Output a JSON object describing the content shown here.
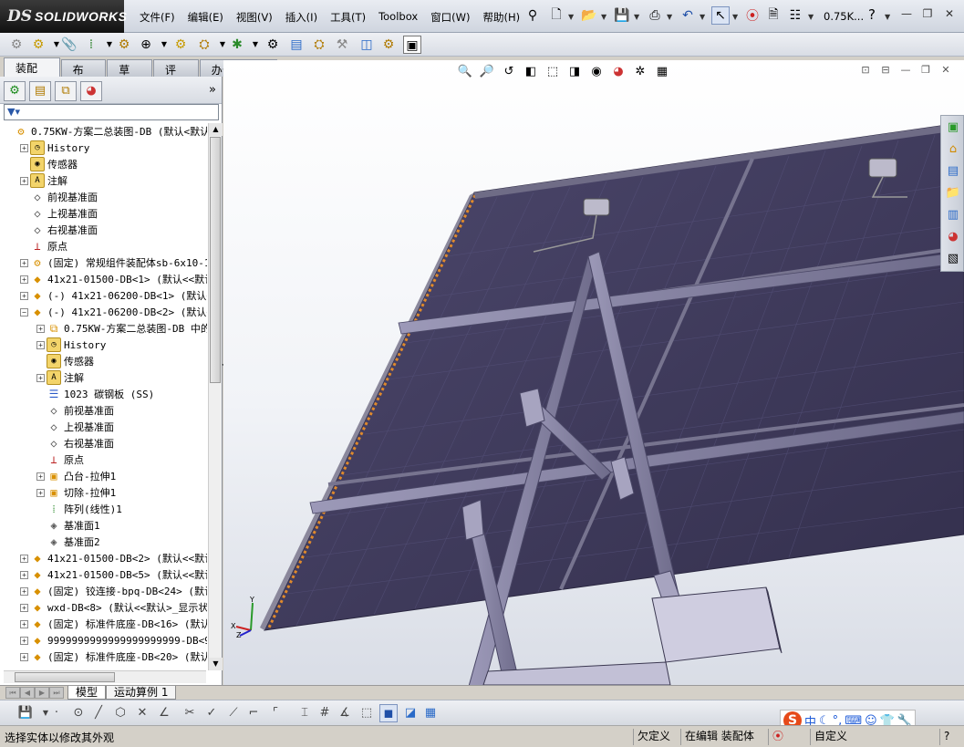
{
  "app": {
    "logo_ds": "DS",
    "logo_name": "SOLIDWORKS",
    "doc_name": "0.75K...",
    "help": "?"
  },
  "menu": [
    "文件(F)",
    "编辑(E)",
    "视图(V)",
    "插入(I)",
    "工具(T)",
    "Toolbox",
    "窗口(W)",
    "帮助(H)"
  ],
  "command_tabs": [
    "装配体",
    "布局",
    "草图",
    "评估",
    "办公室产品"
  ],
  "tree": [
    {
      "text": "0.75KW-方案二总装图-DB  (默认<默认_",
      "icon": "assembly-icon",
      "glyph": "⚙",
      "exp": "",
      "indent": 0
    },
    {
      "text": "History",
      "icon": "history-icon",
      "glyph": "◷",
      "exp": "+",
      "indent": 1
    },
    {
      "text": "传感器",
      "icon": "sensor-icon",
      "glyph": "◉",
      "exp": "",
      "indent": 1
    },
    {
      "text": "注解",
      "icon": "annotation-icon",
      "glyph": "A",
      "exp": "+",
      "indent": 1
    },
    {
      "text": "前视基准面",
      "icon": "plane-icon",
      "glyph": "◇",
      "exp": "",
      "indent": 1
    },
    {
      "text": "上视基准面",
      "icon": "plane-icon",
      "glyph": "◇",
      "exp": "",
      "indent": 1
    },
    {
      "text": "右视基准面",
      "icon": "plane-icon",
      "glyph": "◇",
      "exp": "",
      "indent": 1
    },
    {
      "text": "原点",
      "icon": "origin-icon",
      "glyph": "⊥",
      "exp": "",
      "indent": 1
    },
    {
      "text": "(固定) 常规组件装配体sb-6x10-15",
      "icon": "subassembly-icon",
      "glyph": "⚙",
      "exp": "+",
      "indent": 1
    },
    {
      "text": "41x21-01500-DB<1> (默认<<默认>_",
      "icon": "part-icon",
      "glyph": "◆",
      "exp": "+",
      "indent": 1
    },
    {
      "text": "(-) 41x21-06200-DB<1> (默认<<默",
      "icon": "part-icon",
      "glyph": "◆",
      "exp": "+",
      "indent": 1
    },
    {
      "text": "(-) 41x21-06200-DB<2> (默认<<默",
      "icon": "part-icon",
      "glyph": "◆",
      "exp": "−",
      "indent": 1
    },
    {
      "text": "0.75KW-方案二总装图-DB 中的配",
      "icon": "mates-icon",
      "glyph": "⧉",
      "exp": "+",
      "indent": 2
    },
    {
      "text": "History",
      "icon": "history-icon",
      "glyph": "◷",
      "exp": "+",
      "indent": 2
    },
    {
      "text": "传感器",
      "icon": "sensor-icon",
      "glyph": "◉",
      "exp": "",
      "indent": 2
    },
    {
      "text": "注解",
      "icon": "annotation-icon",
      "glyph": "A",
      "exp": "+",
      "indent": 2
    },
    {
      "text": "1023 碳钢板 (SS)",
      "icon": "material-icon",
      "glyph": "☰",
      "exp": "",
      "indent": 2
    },
    {
      "text": "前视基准面",
      "icon": "plane-icon",
      "glyph": "◇",
      "exp": "",
      "indent": 2
    },
    {
      "text": "上视基准面",
      "icon": "plane-icon",
      "glyph": "◇",
      "exp": "",
      "indent": 2
    },
    {
      "text": "右视基准面",
      "icon": "plane-icon",
      "glyph": "◇",
      "exp": "",
      "indent": 2
    },
    {
      "text": "原点",
      "icon": "origin-icon",
      "glyph": "⊥",
      "exp": "",
      "indent": 2
    },
    {
      "text": "凸台-拉伸1",
      "icon": "extrude-icon",
      "glyph": "▣",
      "exp": "+",
      "indent": 2
    },
    {
      "text": "切除-拉伸1",
      "icon": "cut-extrude-icon",
      "glyph": "▣",
      "exp": "+",
      "indent": 2
    },
    {
      "text": "阵列(线性)1",
      "icon": "linear-pattern-icon",
      "glyph": "⁞",
      "exp": "",
      "indent": 2
    },
    {
      "text": "基准面1",
      "icon": "plane-icon",
      "glyph": "◈",
      "exp": "",
      "indent": 2
    },
    {
      "text": "基准面2",
      "icon": "plane-icon",
      "glyph": "◈",
      "exp": "",
      "indent": 2
    },
    {
      "text": "41x21-01500-DB<2> (默认<<默认>_",
      "icon": "part-icon",
      "glyph": "◆",
      "exp": "+",
      "indent": 1
    },
    {
      "text": "41x21-01500-DB<5> (默认<<默认>_",
      "icon": "part-icon",
      "glyph": "◆",
      "exp": "+",
      "indent": 1
    },
    {
      "text": "(固定) 铰连接-bpq-DB<24> (默认",
      "icon": "part-icon",
      "glyph": "◆",
      "exp": "+",
      "indent": 1
    },
    {
      "text": "wxd-DB<8> (默认<<默认>_显示状态",
      "icon": "part-icon",
      "glyph": "◆",
      "exp": "+",
      "indent": 1
    },
    {
      "text": "(固定) 标准件底座-DB<16> (默认<",
      "icon": "part-icon",
      "glyph": "◆",
      "exp": "+",
      "indent": 1
    },
    {
      "text": "9999999999999999999999-DB<9>",
      "icon": "part-icon",
      "glyph": "◆",
      "exp": "+",
      "indent": 1
    },
    {
      "text": "(固定) 标准件底座-DB<20> (默认<",
      "icon": "part-icon",
      "glyph": "◆",
      "exp": "+",
      "indent": 1
    }
  ],
  "model_tabs": [
    "模型",
    "运动算例 1"
  ],
  "status": {
    "message": "选择实体以修改其外观",
    "state": "欠定义",
    "mode": "在编辑 装配体",
    "custom": "自定义"
  },
  "ime": {
    "logo": "S",
    "lang": "中"
  },
  "triad": {
    "y": "Y",
    "x": "X",
    "z": "Z"
  },
  "colors": {
    "panel_face": "#3f3b5c",
    "frame": "#7a7a88",
    "strut": "#8d8aa8",
    "edge_highlight": "#e08a2c"
  }
}
